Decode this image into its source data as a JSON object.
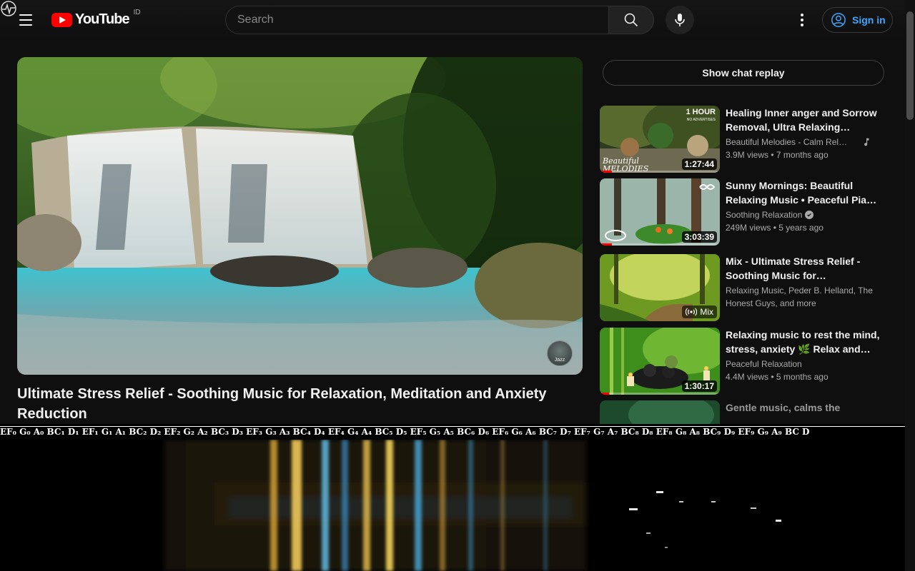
{
  "header": {
    "logo_text": "YouTube",
    "region": "ID",
    "search_placeholder": "Search",
    "signin_label": "Sign in"
  },
  "player": {
    "watermark_text": "Jazz"
  },
  "video": {
    "title": "Ultimate Stress Relief - Soothing Music for Relaxation, Meditation and Anxiety Reduction"
  },
  "sidebar": {
    "chat_replay_label": "Show chat replay",
    "recommendations": [
      {
        "title": "Healing Inner anger and Sorrow Removal, Ultra Relaxing Music…",
        "channel": "Beautiful Melodies - Calm Rela…",
        "badge": "music-note",
        "views": "3.9M views",
        "age": "7 months ago",
        "duration": "1:27:44",
        "thumb_text_top": "1 HOUR",
        "thumb_text_sub": "NO ADVERTISES",
        "thumb_brand": "Beautiful MELODIES",
        "progress_percent": 10
      },
      {
        "title": "Sunny Mornings: Beautiful Relaxing Music • Peaceful Pia…",
        "channel": "Soothing Relaxation",
        "badge": "verified",
        "views": "249M views",
        "age": "5 years ago",
        "duration": "3:03:39",
        "progress_percent": 10
      },
      {
        "title": "Mix - Ultimate Stress Relief - Soothing Music for Relaxation,…",
        "channel": "Relaxing Music, Peder B. Helland, The Honest Guys, and more",
        "mix_label": "Mix"
      },
      {
        "title": "Relaxing music to rest the mind, stress, anxiety 🌿 Relax and…",
        "channel": "Peaceful Relaxation",
        "views": "4.4M views",
        "age": "5 months ago",
        "duration": "1:30:17",
        "progress_percent": 8
      },
      {
        "title": "Gentle music, calms the"
      }
    ]
  },
  "spectrogram": {
    "note_labels": "EF₀ G₀ A₀ BC₁ D₁ EF₁ G₁ A₁ BC₂ D₂ EF₂ G₂ A₂ BC₃ D₃ EF₃ G₃ A₃ BC₄ D₄ EF₄ G₄ A₄ BC₅ D₅ EF₅ G₅ A₅ BC₆ D₆ EF₆ G₆ A₆ BC₇ D₇ EF₇ G₇ A₇ BC₈ D₈ EF₈ G₈ A₈ BC₉ D₉ EF₉ G₉ A₉ BC D"
  },
  "colors": {
    "background": "#0f0f0f",
    "brand_red": "#ff0000",
    "link_blue": "#3ea6ff",
    "secondary_text": "#aaaaaa"
  }
}
